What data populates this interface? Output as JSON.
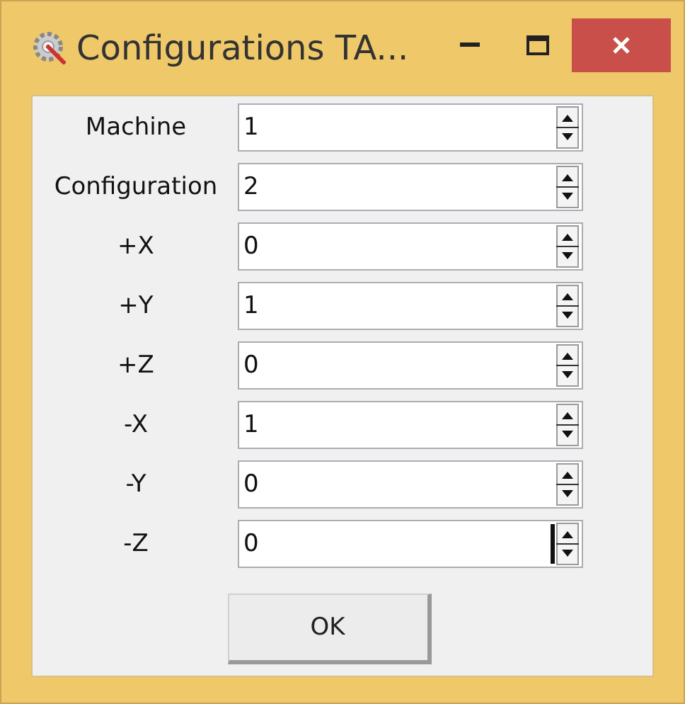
{
  "window": {
    "title": "Configurations TA..."
  },
  "fields": [
    {
      "label": "Machine",
      "value": "1",
      "focused": false
    },
    {
      "label": "Configuration",
      "value": "2",
      "focused": false
    },
    {
      "label": "+X",
      "value": "0",
      "focused": false
    },
    {
      "label": "+Y",
      "value": "1",
      "focused": false
    },
    {
      "label": "+Z",
      "value": "0",
      "focused": false
    },
    {
      "label": "-X",
      "value": "1",
      "focused": false
    },
    {
      "label": "-Y",
      "value": "0",
      "focused": false
    },
    {
      "label": "-Z",
      "value": "0",
      "focused": true
    }
  ],
  "buttons": [
    "OK"
  ]
}
